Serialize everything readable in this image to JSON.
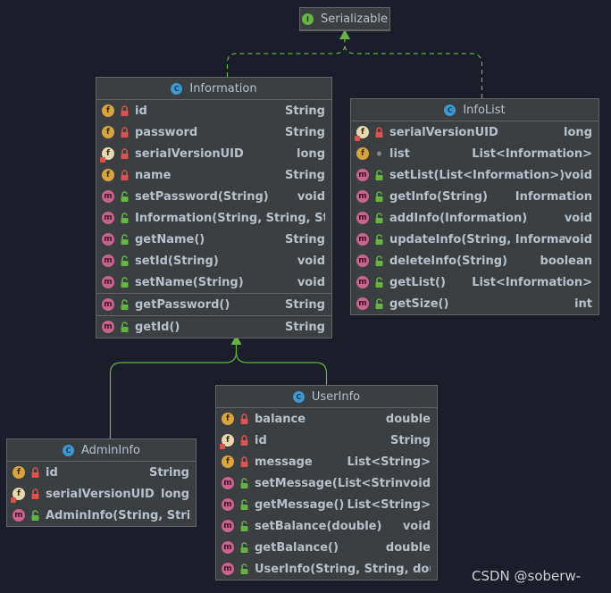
{
  "colors": {
    "background": "#1b1d2b",
    "box": "#3c3f41",
    "border": "#646464",
    "edge_realize": "#62b543",
    "edge_inherit": "#62b543",
    "private": "#d9534f",
    "public": "#62b543"
  },
  "classes": [
    {
      "id": "serializable",
      "kind": "interface",
      "icon": "interface-icon",
      "name": "Serializable",
      "members": []
    },
    {
      "id": "information",
      "kind": "class",
      "icon": "class-icon",
      "name": "Information",
      "members": [
        {
          "badge": "f",
          "vis": "private",
          "name": "id",
          "type": "String"
        },
        {
          "badge": "f",
          "vis": "private",
          "name": "password",
          "type": "String"
        },
        {
          "badge": "fs",
          "vis": "private",
          "name": "serialVersionUID",
          "type": "long"
        },
        {
          "badge": "f",
          "vis": "private",
          "name": "name",
          "type": "String"
        },
        {
          "badge": "m",
          "vis": "public",
          "name": "setPassword(String)",
          "type": "void"
        },
        {
          "badge": "m",
          "vis": "public",
          "name": "Information(String, String, String)",
          "type": ""
        },
        {
          "badge": "m",
          "vis": "public",
          "name": "getName()",
          "type": "String"
        },
        {
          "badge": "m",
          "vis": "public",
          "name": "setId(String)",
          "type": "void"
        },
        {
          "badge": "m",
          "vis": "public",
          "name": "setName(String)",
          "type": "void"
        },
        {
          "badge": "m",
          "vis": "public",
          "name": "getPassword()",
          "type": "String",
          "sep": true
        },
        {
          "badge": "m",
          "vis": "public",
          "name": "getId()",
          "type": "String",
          "sep": true
        }
      ]
    },
    {
      "id": "infolist",
      "kind": "class",
      "icon": "class-icon",
      "name": "InfoList",
      "members": [
        {
          "badge": "fs",
          "vis": "private",
          "name": "serialVersionUID",
          "type": "long"
        },
        {
          "badge": "f",
          "vis": "package",
          "name": "list",
          "type": "List<Information>"
        },
        {
          "badge": "m",
          "vis": "public",
          "name": "setList(List<Information>)",
          "type": "void"
        },
        {
          "badge": "m",
          "vis": "public",
          "name": "getInfo(String)",
          "type": "Information"
        },
        {
          "badge": "m",
          "vis": "public",
          "name": "addInfo(Information)",
          "type": "void"
        },
        {
          "badge": "m",
          "vis": "public",
          "name": "updateInfo(String, Information)",
          "type": "void"
        },
        {
          "badge": "m",
          "vis": "public",
          "name": "deleteInfo(String)",
          "type": "boolean"
        },
        {
          "badge": "m",
          "vis": "public",
          "name": "getList()",
          "type": "List<Information>"
        },
        {
          "badge": "m",
          "vis": "public",
          "name": "getSize()",
          "type": "int"
        }
      ]
    },
    {
      "id": "userinfo",
      "kind": "class",
      "icon": "class-icon",
      "name": "UserInfo",
      "members": [
        {
          "badge": "f",
          "vis": "private",
          "name": "balance",
          "type": "double"
        },
        {
          "badge": "fs",
          "vis": "private",
          "name": "id",
          "type": "String"
        },
        {
          "badge": "f",
          "vis": "private",
          "name": "message",
          "type": "List<String>"
        },
        {
          "badge": "m",
          "vis": "public",
          "name": "setMessage(List<String>)",
          "type": "void"
        },
        {
          "badge": "m",
          "vis": "public",
          "name": "getMessage()",
          "type": "List<String>"
        },
        {
          "badge": "m",
          "vis": "public",
          "name": "setBalance(double)",
          "type": "void"
        },
        {
          "badge": "m",
          "vis": "public",
          "name": "getBalance()",
          "type": "double"
        },
        {
          "badge": "m",
          "vis": "public",
          "name": "UserInfo(String, String, double)",
          "type": ""
        }
      ]
    },
    {
      "id": "admininfo",
      "kind": "class",
      "icon": "class-icon",
      "name": "AdminInfo",
      "members": [
        {
          "badge": "f",
          "vis": "private",
          "name": "id",
          "type": "String"
        },
        {
          "badge": "fs",
          "vis": "private",
          "name": "serialVersionUID",
          "type": "long"
        },
        {
          "badge": "m",
          "vis": "public",
          "name": "AdminInfo(String, String)",
          "type": ""
        }
      ]
    }
  ],
  "relations": [
    {
      "from": "information",
      "to": "serializable",
      "type": "realization"
    },
    {
      "from": "infolist",
      "to": "serializable",
      "type": "realization"
    },
    {
      "from": "admininfo",
      "to": "information",
      "type": "inheritance"
    },
    {
      "from": "userinfo",
      "to": "information",
      "type": "inheritance"
    }
  ],
  "watermark": "CSDN @soberw-"
}
